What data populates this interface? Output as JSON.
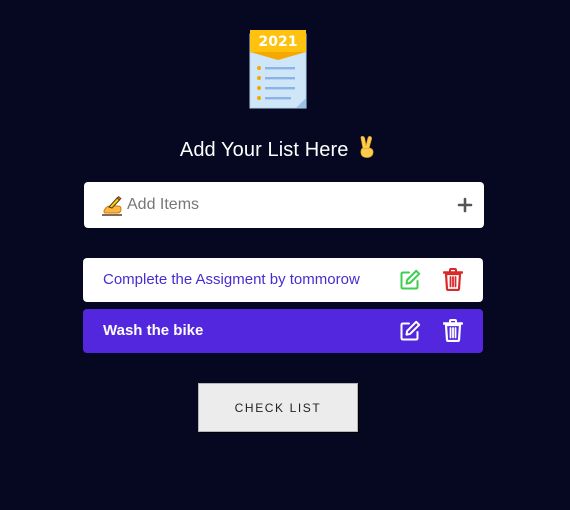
{
  "logo": {
    "year": "2021",
    "icon": "notepad-2021-icon"
  },
  "header": {
    "title": "Add Your List Here",
    "emoji": "✌️"
  },
  "add_input": {
    "placeholder": "Add Items",
    "value": "",
    "leading_icon": "writing-hand-icon",
    "action_icon": "plus-icon"
  },
  "items": [
    {
      "text": "Complete the Assigment by tommorow",
      "style": "white",
      "edit_icon": "edit-icon",
      "delete_icon": "trash-icon"
    },
    {
      "text": "Wash the bike",
      "style": "purple",
      "edit_icon": "edit-icon",
      "delete_icon": "trash-icon"
    }
  ],
  "check_button": {
    "label": "CHECK LIST"
  },
  "colors": {
    "background": "#060822",
    "accent_purple": "#5227dd",
    "edit_green": "#3ccf4e",
    "delete_red": "#d92a2a",
    "item_text_purple": "#4a2bd0"
  }
}
